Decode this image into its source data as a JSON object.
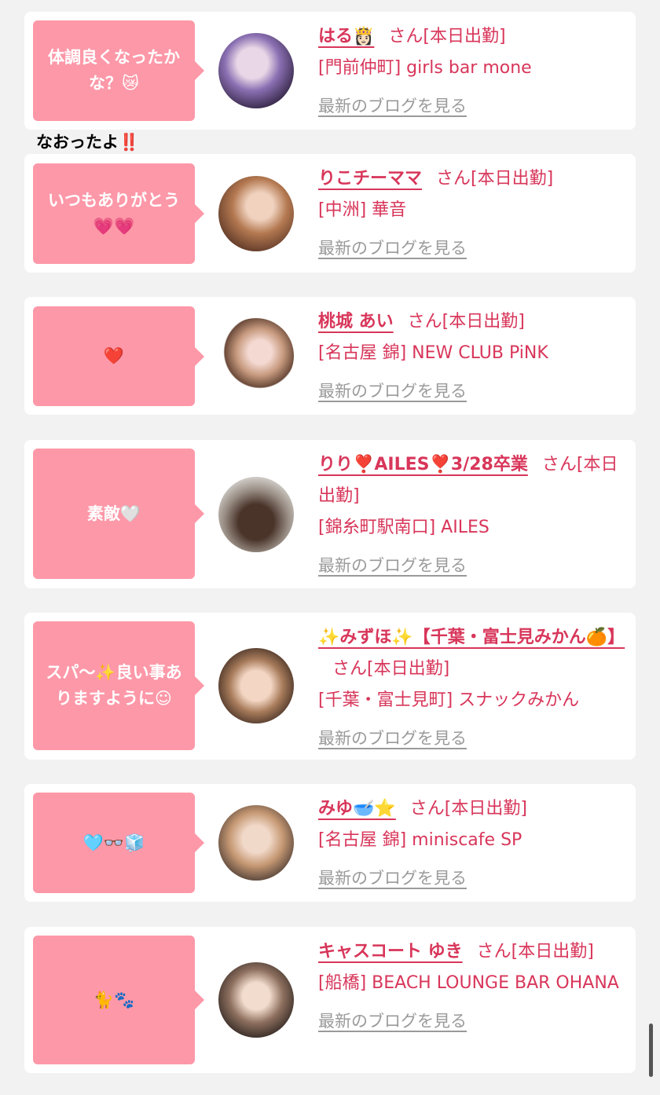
{
  "reply_text": "なおったよ‼️",
  "cards": [
    {
      "comment": "体調良くなったかな？😿",
      "name": "はる👸🏻",
      "san": "さん[本日出勤]",
      "shop": "[門前仲町] girls bar mone",
      "blog_link": "最新のブログを見る"
    },
    {
      "comment": "いつもありがとう💗💗",
      "name": "りこチーママ",
      "san": "さん[本日出勤]",
      "shop": "[中洲] 華音",
      "blog_link": "最新のブログを見る"
    },
    {
      "comment": "❤️",
      "name": "桃城 あい",
      "san": "さん[本日出勤]",
      "shop": "[名古屋 錦] NEW CLUB PiNK",
      "blog_link": "最新のブログを見る"
    },
    {
      "comment": "素敵🤍",
      "name": "りり❣️AILES❣️3/28卒業",
      "san": "さん[本日出勤]",
      "shop": "[錦糸町駅南口] AILES",
      "blog_link": "最新のブログを見る"
    },
    {
      "comment": "スパ〜✨良い事ありますように☺︎",
      "name": "✨みずほ✨【千葉・富士見みかん🍊】",
      "san": "さん[本日出勤]",
      "shop": "[千葉・富士見町] スナックみかん",
      "blog_link": "最新のブログを見る"
    },
    {
      "comment": "🩵👓🧊",
      "name": "みゆ🥣⭐️",
      "san": "さん[本日出勤]",
      "shop": "[名古屋 錦] miniscafe SP",
      "blog_link": "最新のブログを見る"
    },
    {
      "comment": "🐈🐾",
      "name": "キャスコート ゆき",
      "san": "さん[本日出勤]",
      "shop": "[船橋] BEACH LOUNGE BAR OHANA",
      "blog_link": "最新のブログを見る"
    }
  ],
  "colors": {
    "accent": "#d8365a",
    "bubble": "#fd98a8",
    "page_bg": "#f2f2f3",
    "link_gray": "#9a9a9a"
  }
}
